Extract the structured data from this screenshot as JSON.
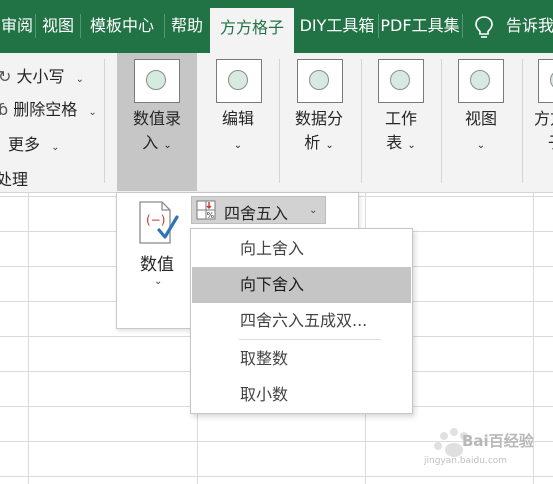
{
  "tabs": [
    {
      "label": "审阅"
    },
    {
      "label": "视图"
    },
    {
      "label": "模板中心"
    },
    {
      "label": "帮助"
    },
    {
      "label": "方方格子",
      "active": true
    },
    {
      "label": "DIY工具箱"
    },
    {
      "label": "PDF工具集"
    },
    {
      "label": "告诉我"
    }
  ],
  "ribbon": {
    "small_items": [
      {
        "label": "大小写",
        "icon": "case-icon"
      },
      {
        "label": "删除空格",
        "icon": "delete-space-icon"
      },
      {
        "label": "更多",
        "icon": "more-icon"
      }
    ],
    "group_label": "处理",
    "big_buttons": [
      {
        "line1": "数值录",
        "line2": "入",
        "pressed": true
      },
      {
        "line1": "编辑",
        "line2": ""
      },
      {
        "line1": "数据分",
        "line2": "析"
      },
      {
        "line1": "工作",
        "line2": "表"
      },
      {
        "line1": "视图",
        "line2": ""
      },
      {
        "line1": "方方格",
        "line2": "子"
      }
    ]
  },
  "popup": {
    "value_button_label": "数值",
    "split_button_label": "四舍五入"
  },
  "menu": {
    "items": [
      {
        "label": "向上舍入"
      },
      {
        "label": "向下舍入",
        "highlighted": true
      },
      {
        "label": "四舍六入五成双..."
      },
      {
        "label": "取整数"
      },
      {
        "label": "取小数"
      }
    ]
  },
  "watermark": {
    "text": "Bai百经验",
    "sub": "jingyan.baidu.com"
  },
  "colors": {
    "accent": "#217346",
    "menu_highlight": "#c5c5c5",
    "pressed": "#c6c6c6"
  }
}
